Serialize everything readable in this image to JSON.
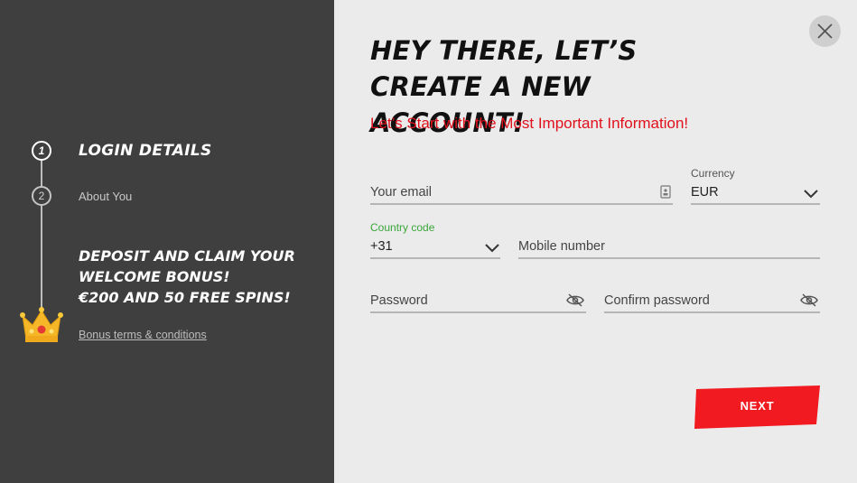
{
  "sidebar": {
    "steps": [
      {
        "number": "1",
        "label": "LOGIN DETAILS"
      },
      {
        "number": "2",
        "label": "About You"
      }
    ],
    "bonus_lines": [
      "DEPOSIT AND CLAIM YOUR",
      "WELCOME BONUS!",
      "€200 AND 50 FREE SPINS!"
    ],
    "bonus_link": "Bonus terms & conditions",
    "crown_icon": "crown-icon"
  },
  "main": {
    "title_lines": [
      "HEY THERE, LET’S",
      "CREATE A NEW ACCOUNT!"
    ],
    "subtitle": "Let’s Start with the Most Important Information!",
    "fields": {
      "email": {
        "placeholder": "Your email"
      },
      "currency": {
        "label": "Currency",
        "value": "EUR"
      },
      "country_code": {
        "label": "Country code",
        "value": "+31"
      },
      "mobile": {
        "placeholder": "Mobile number"
      },
      "password": {
        "placeholder": "Password"
      },
      "confirm_password": {
        "placeholder": "Confirm password"
      }
    },
    "next_label": "NEXT"
  },
  "colors": {
    "sidebar_bg": "#3f3f3f",
    "main_bg": "#ebebeb",
    "accent_red": "#f01a20",
    "label_green": "#3aa63a"
  }
}
